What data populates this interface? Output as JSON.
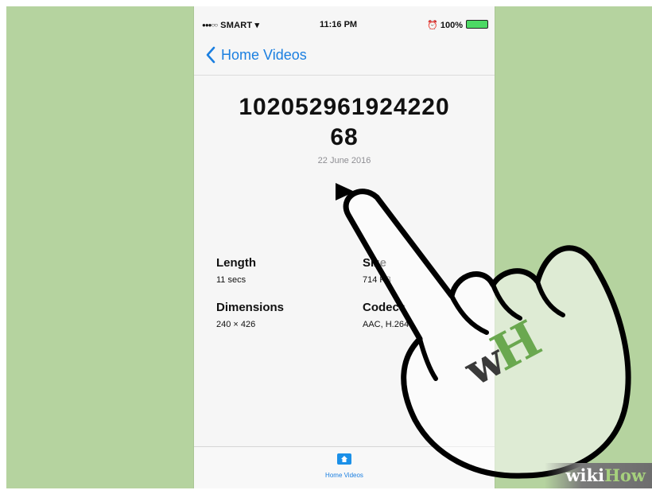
{
  "status_bar": {
    "signal": "●●●○○",
    "carrier": "SMART",
    "time": "11:16 PM",
    "battery": "100%"
  },
  "nav": {
    "back_label": "Home Videos"
  },
  "video": {
    "title_line1": "102052961924220",
    "title_line2": "68",
    "date": "22 June 2016"
  },
  "info": {
    "length_label": "Length",
    "length_value": "11 secs",
    "size_label": "Size",
    "size_value": "714 KB",
    "dimensions_label": "Dimensions",
    "dimensions_value": "240 × 426",
    "codecs_label": "Codecs",
    "codecs_value": "AAC, H.264"
  },
  "tab_bar": {
    "home_label": "Home Videos"
  },
  "logo": {
    "badge": "wH",
    "watermark_wiki": "wiki",
    "watermark_how": "How"
  },
  "colors": {
    "background": "#b5d39f",
    "accent": "#1b7fe0",
    "logo_green": "#6aa84f"
  }
}
